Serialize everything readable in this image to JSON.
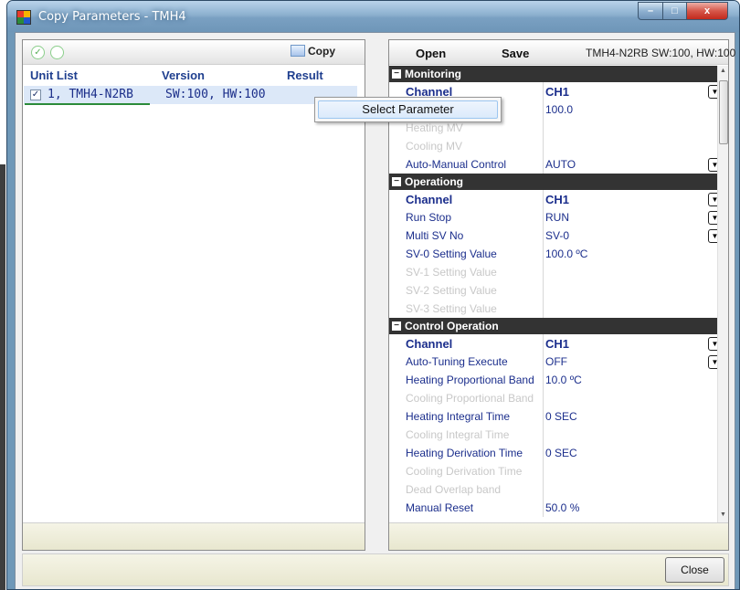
{
  "window": {
    "title": "Copy Parameters - TMH4",
    "close_glyph": "x"
  },
  "left": {
    "copy_label": "Copy",
    "headers": [
      "Unit List",
      "Version",
      "Result"
    ],
    "unit_row": {
      "checked": "✓",
      "unit": "1, TMH4-N2RB",
      "version": "SW:100, HW:100",
      "result": ""
    }
  },
  "context_menu": {
    "item": "Select Parameter"
  },
  "right": {
    "open_label": "Open",
    "save_label": "Save",
    "device_info": "TMH4-N2RB  SW:100, HW:100"
  },
  "sections": [
    {
      "title": "Monitoring",
      "rows": [
        {
          "name": "Channel",
          "value": "CH1",
          "bold": true,
          "disabled": false,
          "dropdown": true
        },
        {
          "name": "PV",
          "value": "100.0",
          "bold": false,
          "disabled": false,
          "dropdown": false
        },
        {
          "name": "Heating MV",
          "value": "",
          "bold": false,
          "disabled": true,
          "dropdown": false
        },
        {
          "name": "Cooling MV",
          "value": "",
          "bold": false,
          "disabled": true,
          "dropdown": false
        },
        {
          "name": "Auto-Manual Control",
          "value": "AUTO",
          "bold": false,
          "disabled": false,
          "dropdown": true
        }
      ]
    },
    {
      "title": "Operationg",
      "rows": [
        {
          "name": "Channel",
          "value": "CH1",
          "bold": true,
          "disabled": false,
          "dropdown": true
        },
        {
          "name": "Run Stop",
          "value": "RUN",
          "bold": false,
          "disabled": false,
          "dropdown": true
        },
        {
          "name": "Multi SV No",
          "value": "SV-0",
          "bold": false,
          "disabled": false,
          "dropdown": true
        },
        {
          "name": "SV-0 Setting Value",
          "value": "100.0 ºC",
          "bold": false,
          "disabled": false,
          "dropdown": false
        },
        {
          "name": "SV-1 Setting Value",
          "value": "",
          "bold": false,
          "disabled": true,
          "dropdown": false
        },
        {
          "name": "SV-2 Setting Value",
          "value": "",
          "bold": false,
          "disabled": true,
          "dropdown": false
        },
        {
          "name": "SV-3 Setting Value",
          "value": "",
          "bold": false,
          "disabled": true,
          "dropdown": false
        }
      ]
    },
    {
      "title": "Control Operation",
      "rows": [
        {
          "name": "Channel",
          "value": "CH1",
          "bold": true,
          "disabled": false,
          "dropdown": true
        },
        {
          "name": "Auto-Tuning Execute",
          "value": "OFF",
          "bold": false,
          "disabled": false,
          "dropdown": true
        },
        {
          "name": "Heating Proportional Band",
          "value": "10.0 ºC",
          "bold": false,
          "disabled": false,
          "dropdown": false
        },
        {
          "name": "Cooling Proportional Band",
          "value": "",
          "bold": false,
          "disabled": true,
          "dropdown": false
        },
        {
          "name": "Heating Integral Time",
          "value": "0 SEC",
          "bold": false,
          "disabled": false,
          "dropdown": false
        },
        {
          "name": "Cooling Integral Time",
          "value": "",
          "bold": false,
          "disabled": true,
          "dropdown": false
        },
        {
          "name": "Heating Derivation Time",
          "value": "0 SEC",
          "bold": false,
          "disabled": false,
          "dropdown": false
        },
        {
          "name": "Cooling Derivation Time",
          "value": "",
          "bold": false,
          "disabled": true,
          "dropdown": false
        },
        {
          "name": "Dead Overlap band",
          "value": "",
          "bold": false,
          "disabled": true,
          "dropdown": false
        },
        {
          "name": "Manual Reset",
          "value": "50.0 %",
          "bold": false,
          "disabled": false,
          "dropdown": false
        }
      ]
    }
  ],
  "footer": {
    "close_label": "Close"
  }
}
